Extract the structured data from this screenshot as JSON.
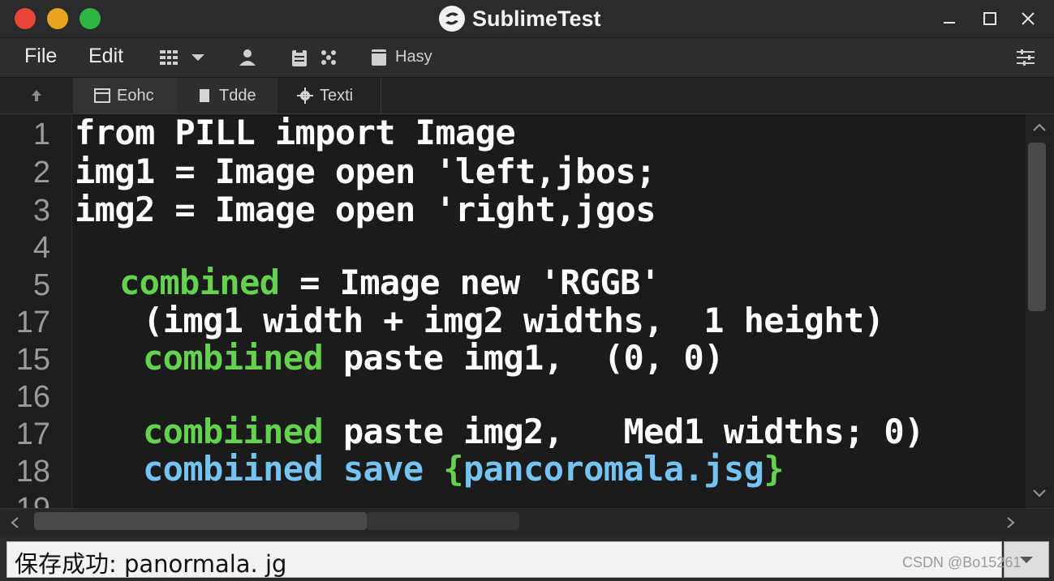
{
  "window": {
    "title": "SublimeTest"
  },
  "menu": {
    "file": "File",
    "edit": "Edit",
    "tool_label": "Hasy"
  },
  "tabs": [
    {
      "label": "Eohc"
    },
    {
      "label": "Tdde"
    },
    {
      "label": "Texti"
    }
  ],
  "editor": {
    "line_numbers": [
      "1",
      "2",
      "3",
      "4",
      "5",
      "17",
      "15",
      "16",
      "17",
      "18",
      "19"
    ],
    "lines": {
      "l1": "from PILL import Image",
      "l2": "img1 = Image open 'left,jbos;",
      "l3": "img2 = Image open 'right,jgos",
      "l5_kw": "combined",
      "l5_rest": " = Image new 'RGGB'",
      "l6": "(img1 width + img2 widths,  1 height)",
      "l7_kw": "combiined",
      "l7_rest": " paste img1,  (0, 0)",
      "l8_kw": "combiined",
      "l8_rest": " paste img2,   Med1 widths; 0)",
      "l9_kw": "combiined save ",
      "l9_brace_open": "{",
      "l9_arg": "pancoromala.jsg",
      "l9_brace_close": "}"
    }
  },
  "status": {
    "message": "保存成功: panormala. jg"
  },
  "watermark": "CSDN @Bo15261",
  "colors": {
    "keyword_green": "#64d24f",
    "keyword_blue": "#75c3f0",
    "text": "#ffffff"
  }
}
